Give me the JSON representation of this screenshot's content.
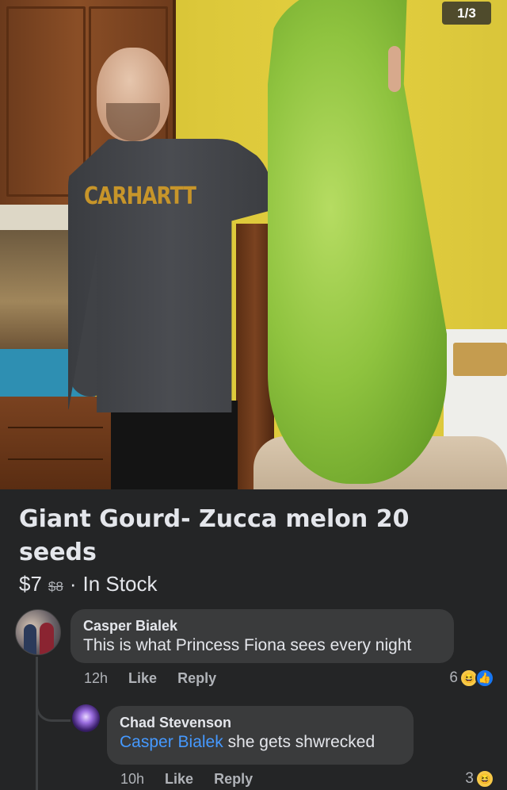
{
  "photo": {
    "counter": "1/3",
    "shirt_text": "CARHARTT"
  },
  "listing": {
    "title": "Giant Gourd- Zucca melon 20 seeds",
    "price": "$7",
    "old_price": "$8",
    "separator": "·",
    "availability": "In Stock"
  },
  "comments": [
    {
      "author": "Casper Bialek",
      "text": "This is what Princess Fiona sees every night",
      "time": "12h",
      "like_label": "Like",
      "reply_label": "Reply",
      "reaction_count": "6",
      "reactions": [
        "haha-icon",
        "like-icon"
      ]
    },
    {
      "author": "Chad Stevenson",
      "mention": "Casper Bialek",
      "text": " she gets shwrecked",
      "time": "10h",
      "like_label": "Like",
      "reply_label": "Reply",
      "reaction_count": "3",
      "reactions": [
        "haha-icon"
      ]
    }
  ],
  "colors": {
    "background": "#242526",
    "bubble": "#3a3b3c",
    "mention": "#4599ff",
    "like": "#1877f2"
  }
}
